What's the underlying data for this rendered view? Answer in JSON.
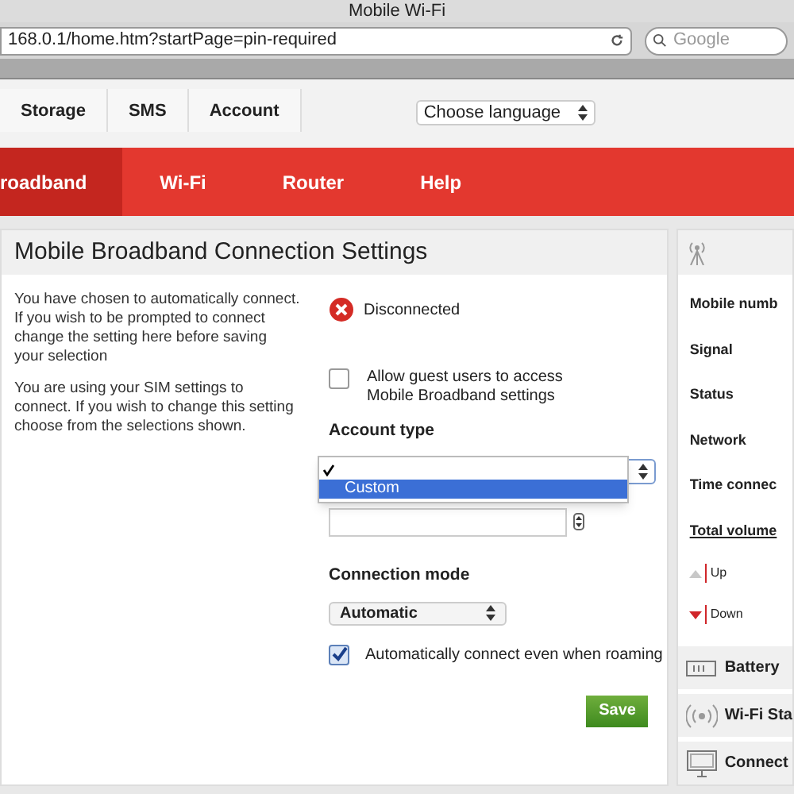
{
  "window": {
    "title": "Mobile Wi-Fi"
  },
  "browser": {
    "url": "168.0.1/home.htm?startPage=pin-required",
    "search_placeholder": "Google"
  },
  "tabs": [
    {
      "label": "Storage"
    },
    {
      "label": "SMS"
    },
    {
      "label": "Account"
    }
  ],
  "language_select": {
    "value": "Choose language"
  },
  "nav": [
    {
      "label": "roadband",
      "selected": true
    },
    {
      "label": "Wi-Fi",
      "selected": false
    },
    {
      "label": "Router",
      "selected": false
    },
    {
      "label": "Help",
      "selected": false
    }
  ],
  "panel": {
    "title": "Mobile Broadband Connection Settings",
    "paragraphs": [
      "You have chosen to automatically connect. If you wish to be prompted to connect change the setting here before saving your selection",
      "You are using your SIM settings to connect. If you wish to change this setting choose from the selections shown."
    ],
    "status": "Disconnected",
    "guest_access": {
      "label": "Allow guest users to access Mobile Broadband settings",
      "checked": false
    },
    "account_type": {
      "label": "Account type",
      "options": [
        {
          "checked": true,
          "selected": false
        },
        {
          "label": "Custom",
          "checked": false,
          "selected": true
        }
      ]
    },
    "connection_mode": {
      "label": "Connection mode",
      "value": "Automatic"
    },
    "roaming": {
      "label": "Automatically connect even when roaming",
      "checked": true
    },
    "save": "Save"
  },
  "side": {
    "rows": [
      {
        "label": "Mobile numb",
        "kind": "plain"
      },
      {
        "label": "Signal",
        "kind": "plain"
      },
      {
        "label": "Status",
        "kind": "plain"
      },
      {
        "label": "Network",
        "kind": "plain"
      },
      {
        "label": "Time connec",
        "kind": "plain"
      },
      {
        "label": "Total volume",
        "kind": "underline"
      }
    ],
    "legend": [
      {
        "label": "Up",
        "color": "#c8c8c8"
      },
      {
        "label": "Down",
        "color": "#d0262a"
      }
    ],
    "sections": [
      {
        "label": "Battery",
        "kind": "battery"
      },
      {
        "label": "Wi-Fi Sta",
        "kind": "wifi"
      },
      {
        "label": "Connect",
        "kind": "monitor"
      }
    ]
  }
}
